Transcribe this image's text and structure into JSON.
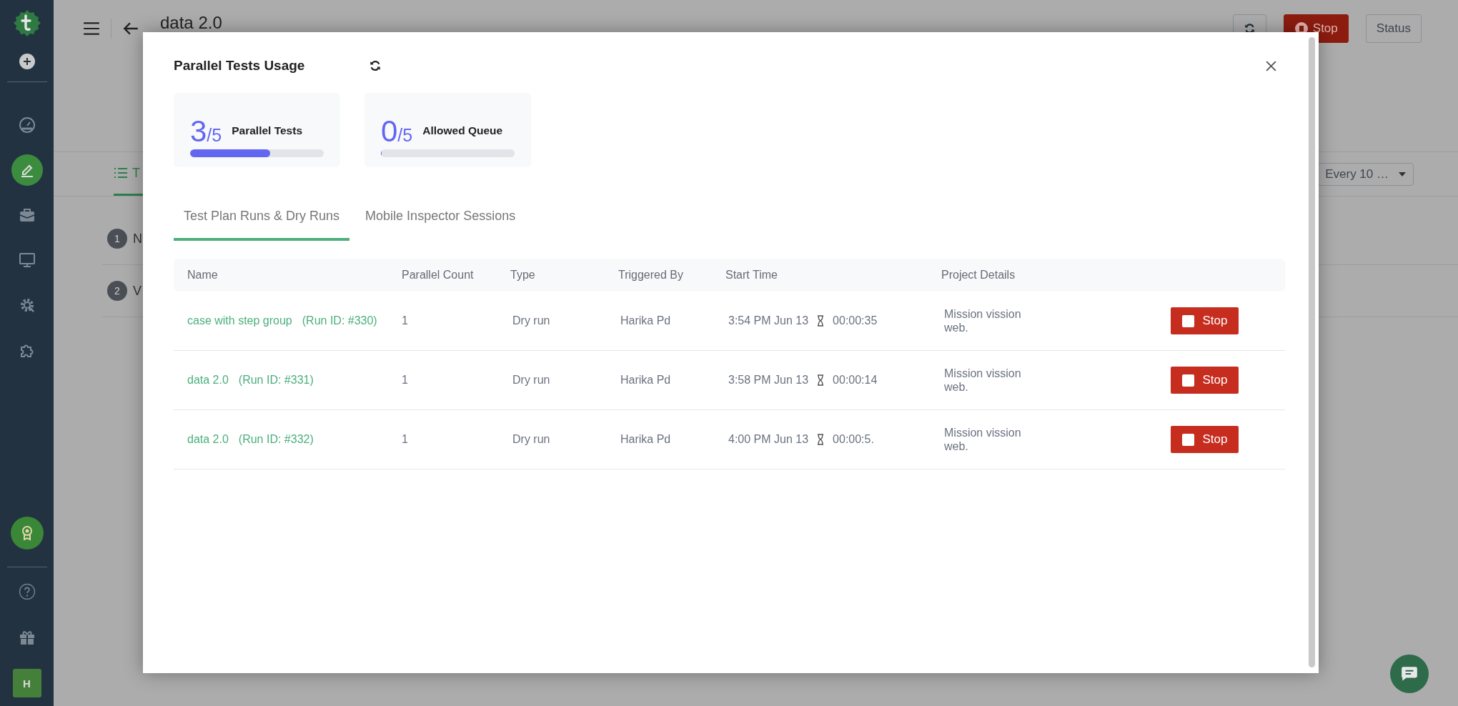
{
  "sidebar": {
    "avatar": "H",
    "items": [
      {
        "selected": false
      },
      {
        "selected": true
      },
      {
        "selected": false
      },
      {
        "selected": false
      },
      {
        "selected": false
      },
      {
        "selected": false
      }
    ]
  },
  "page": {
    "title": "data 2.0",
    "stop_button": "Stop",
    "status_button": "Status",
    "tab_label": "T",
    "interval": "Every 10 …",
    "steps": [
      {
        "number": "1",
        "label": "N"
      },
      {
        "number": "2",
        "label": "V"
      }
    ]
  },
  "modal": {
    "title": "Parallel Tests Usage",
    "meters": [
      {
        "used": "3",
        "total": "/5",
        "label": "Parallel Tests",
        "level": 0.6
      },
      {
        "used": "0",
        "total": "/5",
        "label": "Allowed Queue",
        "level": 0
      }
    ],
    "tabs": [
      {
        "label": "Test Plan Runs & Dry Runs",
        "selected": true
      },
      {
        "label": "Mobile Inspector Sessions",
        "selected": false
      }
    ],
    "table": {
      "columns": [
        "Name",
        "Parallel Count",
        "Type",
        "Triggered By",
        "Start Time",
        "Project Details"
      ],
      "rows": [
        {
          "name": "case with step group",
          "run_id": "(Run ID: #330)",
          "parallel_count": "1",
          "type": "Dry run",
          "triggered_by": "Harika Pd",
          "start_time": "3:54 PM Jun 13",
          "duration": "00:00:35",
          "project": "Mission vission web.",
          "action": "Stop"
        },
        {
          "name": "data 2.0",
          "run_id": "(Run ID: #331)",
          "parallel_count": "1",
          "type": "Dry run",
          "triggered_by": "Harika Pd",
          "start_time": "3:58 PM Jun 13",
          "duration": "00:00:14",
          "project": "Mission vission web.",
          "action": "Stop"
        },
        {
          "name": "data 2.0",
          "run_id": "(Run ID: #332)",
          "parallel_count": "1",
          "type": "Dry run",
          "triggered_by": "Harika Pd",
          "start_time": "4:00 PM Jun 13",
          "duration": "00:00:5.",
          "project": "Mission vission web.",
          "action": "Stop"
        }
      ]
    }
  }
}
